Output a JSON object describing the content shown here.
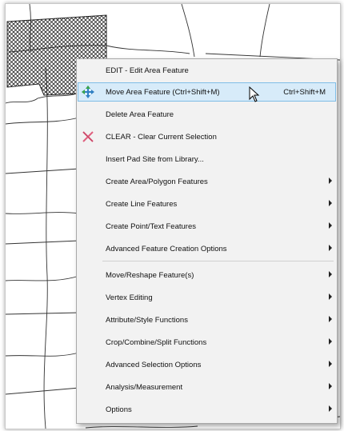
{
  "map": {
    "icons": {
      "selected_area": "hatched-area-selection"
    }
  },
  "context_menu": {
    "items": [
      {
        "label": "EDIT - Edit Area Feature",
        "shortcut": "",
        "submenu": false,
        "icon": ""
      },
      {
        "label": "Move Area Feature (Ctrl+Shift+M)",
        "shortcut": "Ctrl+Shift+M",
        "submenu": false,
        "icon": "move-arrows-icon",
        "highlighted": true
      },
      {
        "label": "Delete Area Feature",
        "shortcut": "",
        "submenu": false,
        "icon": ""
      },
      {
        "label": "CLEAR - Clear Current Selection",
        "shortcut": "",
        "submenu": false,
        "icon": "clear-x-icon"
      },
      {
        "label": "Insert Pad Site from Library...",
        "shortcut": "",
        "submenu": false,
        "icon": ""
      },
      {
        "label": "Create Area/Polygon Features",
        "shortcut": "",
        "submenu": true,
        "icon": ""
      },
      {
        "label": "Create Line Features",
        "shortcut": "",
        "submenu": true,
        "icon": ""
      },
      {
        "label": "Create Point/Text Features",
        "shortcut": "",
        "submenu": true,
        "icon": ""
      },
      {
        "label": "Advanced Feature Creation Options",
        "shortcut": "",
        "submenu": true,
        "icon": ""
      },
      {
        "label": "Move/Reshape Feature(s)",
        "shortcut": "",
        "submenu": true,
        "icon": ""
      },
      {
        "label": "Vertex Editing",
        "shortcut": "",
        "submenu": true,
        "icon": ""
      },
      {
        "label": "Attribute/Style Functions",
        "shortcut": "",
        "submenu": true,
        "icon": ""
      },
      {
        "label": "Crop/Combine/Split Functions",
        "shortcut": "",
        "submenu": true,
        "icon": ""
      },
      {
        "label": "Advanced Selection Options",
        "shortcut": "",
        "submenu": true,
        "icon": ""
      },
      {
        "label": "Analysis/Measurement",
        "shortcut": "",
        "submenu": true,
        "icon": ""
      },
      {
        "label": "Options",
        "shortcut": "",
        "submenu": true,
        "icon": ""
      }
    ],
    "colors": {
      "highlight": "#d7ebf9",
      "highlight_border": "#7fbde6",
      "clear_icon": "#e0607e"
    }
  }
}
